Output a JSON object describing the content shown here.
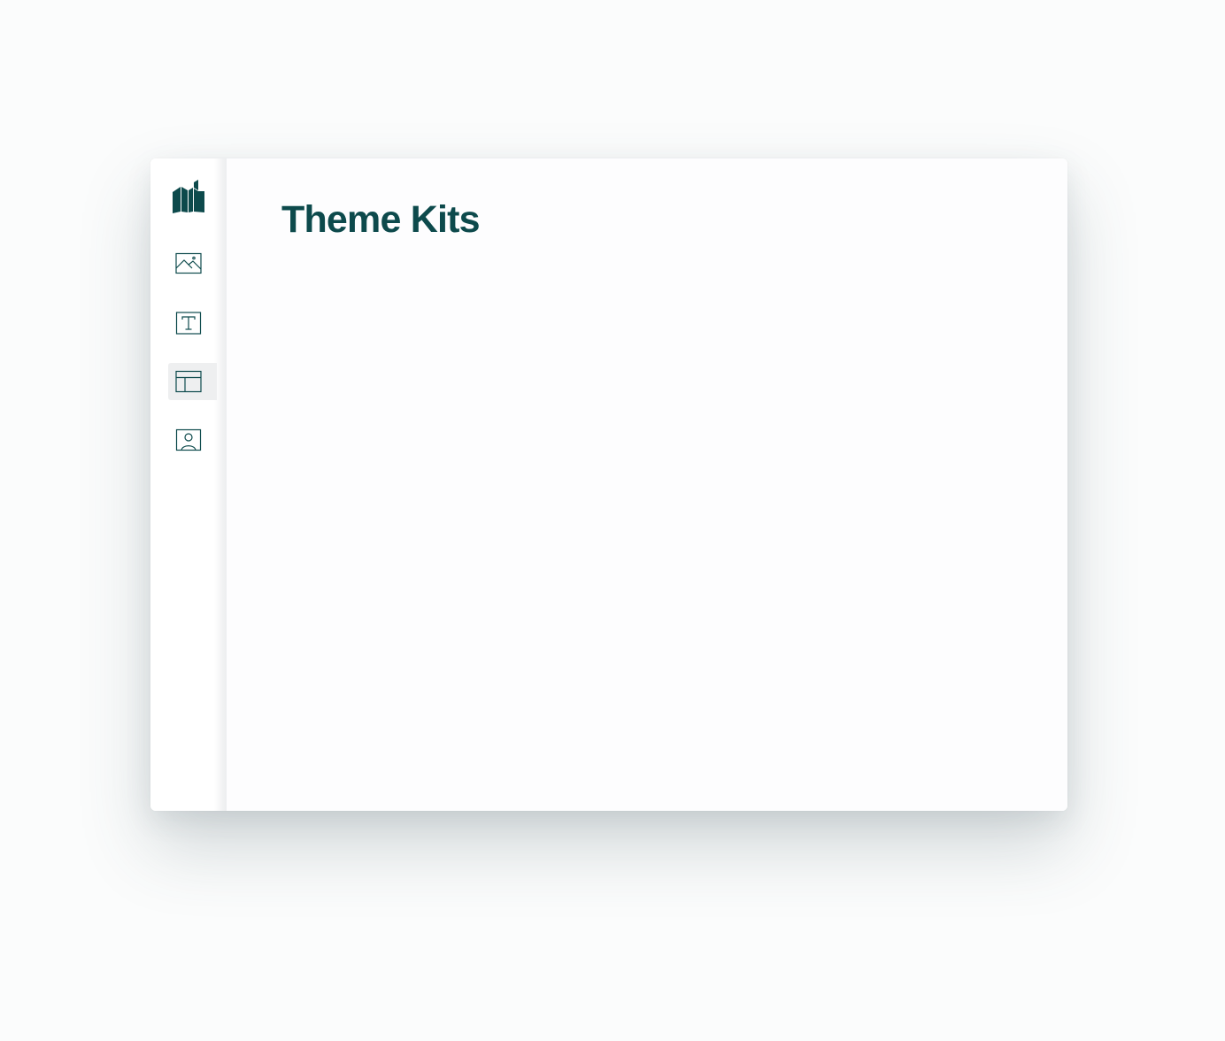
{
  "app": {
    "brand_color": "#0d4a4c",
    "logo_icon": "book-logo-icon"
  },
  "sidebar": {
    "items": [
      {
        "icon": "image-icon",
        "active": false
      },
      {
        "icon": "text-icon",
        "active": false
      },
      {
        "icon": "layout-icon",
        "active": true
      },
      {
        "icon": "user-card-icon",
        "active": false
      }
    ]
  },
  "main": {
    "title": "Theme Kits"
  }
}
